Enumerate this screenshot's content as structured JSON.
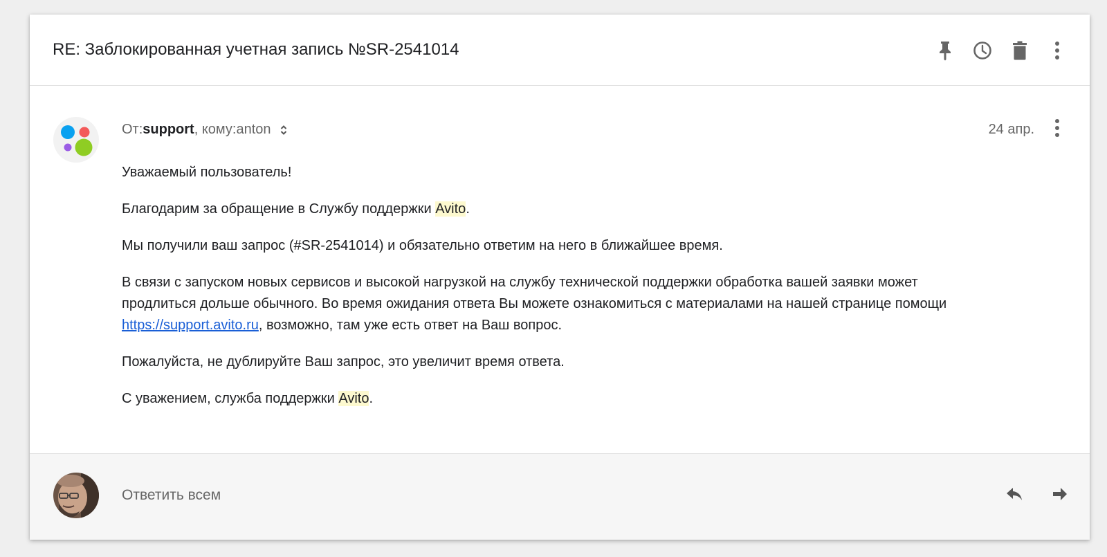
{
  "header": {
    "subject": "RE: Заблокированная учетная запись №SR-2541014",
    "actions": [
      "pin-icon",
      "clock-icon",
      "trash-icon",
      "more-vertical-icon"
    ]
  },
  "message": {
    "from_label": "От: ",
    "sender": "support",
    "to_label": ", кому: ",
    "recipient": "anton",
    "date": "24 апр.",
    "paragraphs": {
      "p1": "Уважаемый пользователь!",
      "p2_before": "Благодарим за обращение в Службу поддержки ",
      "p2_brand": "Avito",
      "p2_after": ".",
      "p3": "Мы получили ваш запрос (#SR-2541014) и обязательно ответим на него в ближайшее время.",
      "p4_before": "В связи с запуском новых сервисов и высокой нагрузкой на службу технической поддержки обработка вашей заявки может продлиться дольше обычного. Во время ожидания ответа Вы можете ознакомиться с материалами на нашей странице помощи ",
      "p4_link": "https://support.avito.ru",
      "p4_after": ", возможно, там уже есть ответ на Ваш вопрос.",
      "p5": "Пожалуйста, не дублируйте Ваш запрос, это увеличит время ответа.",
      "p6_before": "С уважением, служба поддержки ",
      "p6_brand": "Avito",
      "p6_after": "."
    }
  },
  "footer": {
    "reply_all_label": "Ответить всем",
    "actions": [
      "reply-icon",
      "forward-icon"
    ]
  },
  "colors": {
    "page_bg": "#efefef",
    "card_bg": "#ffffff",
    "footer_bg": "#f6f6f6",
    "link": "#1a5fd6",
    "highlight": "#fdf9cf",
    "icon": "#666666",
    "avito_blue": "#0aa1f0",
    "avito_red": "#f35a5a",
    "avito_purple": "#9b5de5",
    "avito_green": "#8fcd23"
  }
}
